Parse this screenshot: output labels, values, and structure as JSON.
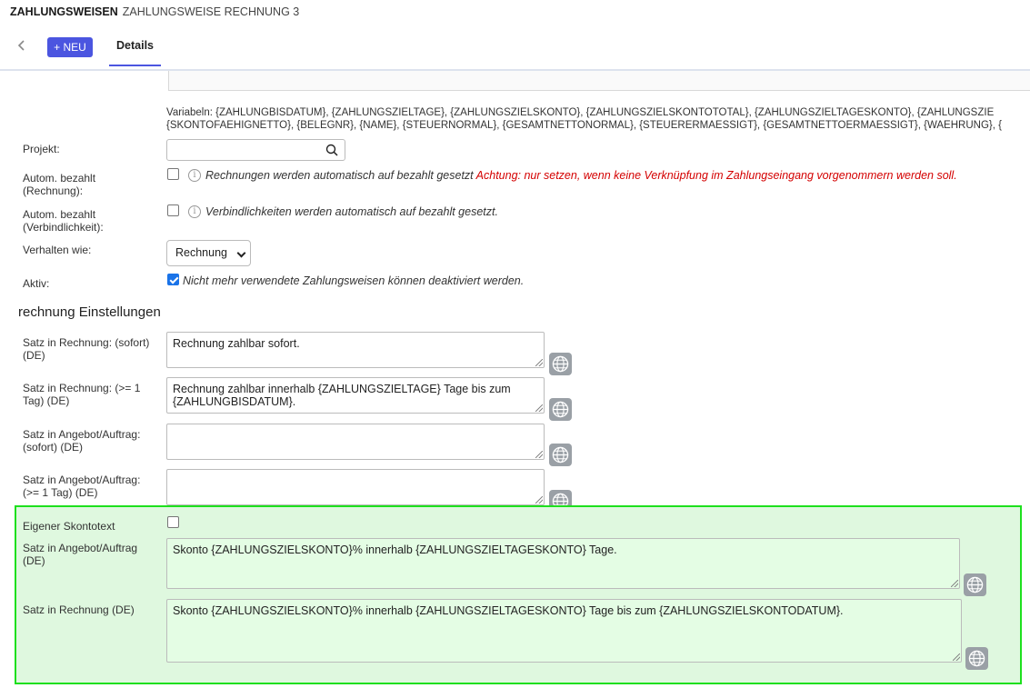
{
  "breadcrumb": {
    "section": "ZAHLUNGSWEISEN",
    "record": "ZAHLUNGSWEISE RECHNUNG 3"
  },
  "toolbar": {
    "back_icon": "chevron-left-icon",
    "new_label": "+ NEU",
    "tab_details": "Details"
  },
  "variables": {
    "line1": "Variabeln: {ZAHLUNGBISDATUM}, {ZAHLUNGSZIELTAGE}, {ZAHLUNGSZIELSKONTO}, {ZAHLUNGSZIELSKONTOTOTAL}, {ZAHLUNGSZIELTAGESKONTO}, {ZAHLUNGSZIE",
    "line2": "{SKONTOFAEHIGNETTO}, {BELEGNR}, {NAME}, {STEUERNORMAL}, {GESAMTNETTONORMAL}, {STEUERERMAESSIGT}, {GESAMTNETTOERMAESSIGT}, {WAEHRUNG}, {"
  },
  "form": {
    "projekt_label": "Projekt:",
    "projekt_value": "",
    "auto_rechnung_label_1": "Autom. bezahlt",
    "auto_rechnung_label_2": "(Rechnung):",
    "auto_rechnung_hint": "Rechnungen werden automatisch auf bezahlt gesetzt",
    "auto_rechnung_warning": "Achtung: nur setzen, wenn keine Verknüpfung im Zahlungseingang vorgenommern werden soll.",
    "auto_verb_label_1": "Autom. bezahlt",
    "auto_verb_label_2": "(Verbindlichkeit):",
    "auto_verb_hint": "Verbindlichkeiten werden automatisch auf bezahlt gesetzt.",
    "verhalten_label": "Verhalten wie:",
    "verhalten_value": "Rechnung",
    "aktiv_label": "Aktiv:",
    "aktiv_hint": "Nicht mehr verwendete Zahlungsweisen können deaktiviert werden.",
    "aktiv_checked": true
  },
  "section_title": "rechnung Einstellungen",
  "texts": {
    "r_sofort_label_1": "Satz in Rechnung: (sofort)",
    "r_sofort_label_2": "(DE)",
    "r_sofort_value": "Rechnung zahlbar sofort.",
    "r_tag_label_1": "Satz in Rechnung: (>= 1",
    "r_tag_label_2": "Tag) (DE)",
    "r_tag_value_1": "Rechnung zahlbar innerhalb {ZAHLUNGSZIELTAGE} Tage bis zum",
    "r_tag_value_2": "{ZAHLUNGBISDATUM}.",
    "a_sofort_label_1": "Satz in Angebot/Auftrag:",
    "a_sofort_label_2": "(sofort) (DE)",
    "a_sofort_value": "",
    "a_tag_label_1": "Satz in Angebot/Auftrag:",
    "a_tag_label_2": "(>= 1 Tag) (DE)",
    "a_tag_value": ""
  },
  "skonto": {
    "eigener_label": "Eigener Skontotext",
    "angebot_label_1": "Satz in Angebot/Auftrag",
    "angebot_label_2": "(DE)",
    "angebot_value": "Skonto {ZAHLUNGSZIELSKONTO}% innerhalb {ZAHLUNGSZIELTAGESKONTO} Tage.",
    "rechnung_label": "Satz in Rechnung (DE)",
    "rechnung_value": "Skonto {ZAHLUNGSZIELSKONTO}% innerhalb {ZAHLUNGSZIELTAGESKONTO} Tage bis zum {ZAHLUNGSZIELSKONTODATUM}."
  },
  "colors": {
    "accent": "#4b55e0",
    "highlight_border": "#1ee01e",
    "highlight_bg": "#dff8df",
    "warning": "#d40000"
  }
}
